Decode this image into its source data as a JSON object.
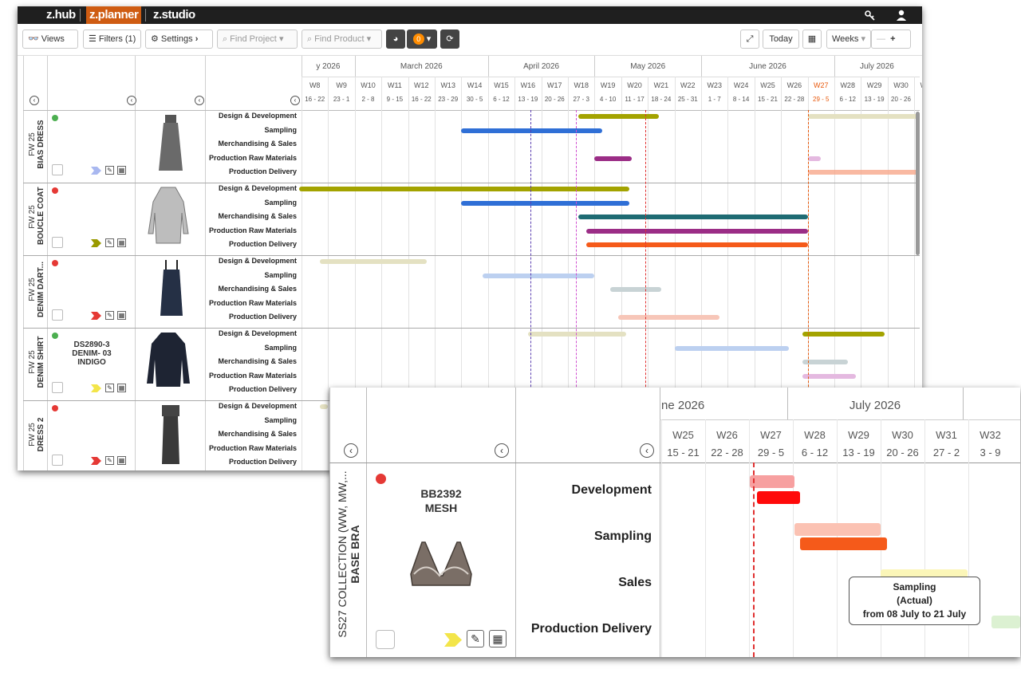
{
  "brand": {
    "hub": "z.hub",
    "planner": "z.planner",
    "studio": "z.studio",
    "accent": "#d2691e"
  },
  "toolbar": {
    "views": "Views",
    "filters": "Filters (1)",
    "settings": "Settings",
    "find_project": "Find Project",
    "find_product": "Find Product",
    "badge": "0",
    "today": "Today",
    "weeks": "Weeks"
  },
  "months": [
    "y 2026",
    "March 2026",
    "April 2026",
    "May 2026",
    "June 2026",
    "July 2026"
  ],
  "weeks": [
    {
      "w": "W8",
      "d": "16 - 22"
    },
    {
      "w": "W9",
      "d": "23 - 1"
    },
    {
      "w": "W10",
      "d": "2 - 8"
    },
    {
      "w": "W11",
      "d": "9 - 15"
    },
    {
      "w": "W12",
      "d": "16 - 22"
    },
    {
      "w": "W13",
      "d": "23 - 29"
    },
    {
      "w": "W14",
      "d": "30 - 5"
    },
    {
      "w": "W15",
      "d": "6 - 12"
    },
    {
      "w": "W16",
      "d": "13 - 19"
    },
    {
      "w": "W17",
      "d": "20 - 26"
    },
    {
      "w": "W18",
      "d": "27 - 3"
    },
    {
      "w": "W19",
      "d": "4 - 10"
    },
    {
      "w": "W20",
      "d": "11 - 17"
    },
    {
      "w": "W21",
      "d": "18 - 24"
    },
    {
      "w": "W22",
      "d": "25 - 31"
    },
    {
      "w": "W23",
      "d": "1 - 7"
    },
    {
      "w": "W24",
      "d": "8 - 14"
    },
    {
      "w": "W25",
      "d": "15 - 21"
    },
    {
      "w": "W26",
      "d": "22 - 28"
    },
    {
      "w": "W27",
      "d": "29 - 5"
    },
    {
      "w": "W28",
      "d": "6 - 12"
    },
    {
      "w": "W29",
      "d": "13 - 19"
    },
    {
      "w": "W30",
      "d": "20 - 26"
    },
    {
      "w": "W31",
      "d": "2"
    }
  ],
  "current_week_index": 19,
  "stages": [
    "Design & Development",
    "Sampling",
    "Merchandising & Sales",
    "Production Raw Materials",
    "Production Delivery"
  ],
  "products": [
    {
      "season": "FW 25",
      "name": "BIAS DRESS",
      "status": "#4caf50",
      "flag": "#a9b8f0",
      "sku": ""
    },
    {
      "season": "FW 25",
      "name": "BOUCLE COAT",
      "status": "#e53935",
      "flag": "#9a9a00",
      "sku": ""
    },
    {
      "season": "FW 25",
      "name": "DENIM DART...",
      "status": "#e53935",
      "flag": "#e53935",
      "sku": ""
    },
    {
      "season": "FW 25",
      "name": "DENIM SHIRT",
      "status": "#4caf50",
      "flag": "#f3e54a",
      "sku": "DS2890-3\nDENIM- 03\nINDIGO"
    },
    {
      "season": "FW 25",
      "name": "DRESS 2",
      "status": "#e53935",
      "flag": "#e53935",
      "sku": ""
    }
  ],
  "zoom": {
    "months": [
      "ne 2026",
      "July 2026"
    ],
    "weeks": [
      {
        "w": "W25",
        "d": "15 - 21"
      },
      {
        "w": "W26",
        "d": "22 - 28"
      },
      {
        "w": "W27",
        "d": "29 - 5"
      },
      {
        "w": "W28",
        "d": "6 - 12"
      },
      {
        "w": "W29",
        "d": "13 - 19"
      },
      {
        "w": "W30",
        "d": "20 - 26"
      },
      {
        "w": "W31",
        "d": "27 - 2"
      },
      {
        "w": "W32",
        "d": "3 - 9"
      }
    ],
    "season": "SS27 COLLECTION (WW, MW,...",
    "product": "BASE BRA",
    "sku": "BB2392\nMESH",
    "stages": [
      "Development",
      "Sampling",
      "Sales",
      "Production Delivery"
    ],
    "tooltip": {
      "l1": "Sampling",
      "l2": "(Actual)",
      "l3": "from 08 July to 21 July"
    },
    "status": "#e53935",
    "flag": "#f3e54a"
  }
}
